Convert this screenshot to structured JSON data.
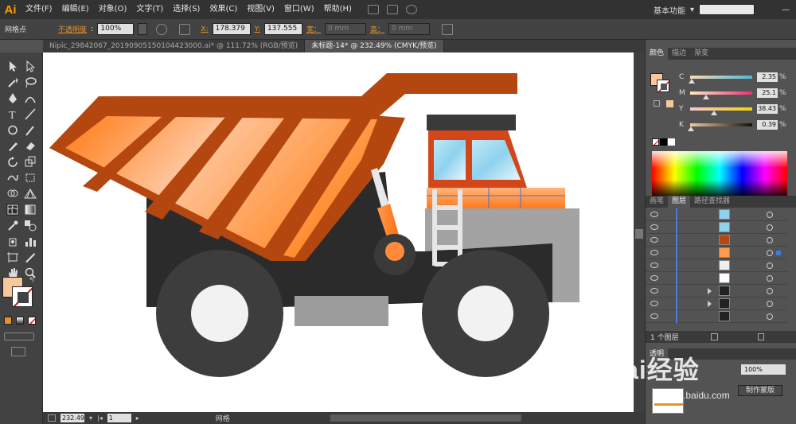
{
  "app": {
    "logo": "Ai"
  },
  "menu": [
    "文件(F)",
    "编辑(E)",
    "对象(O)",
    "文字(T)",
    "选择(S)",
    "效果(C)",
    "视图(V)",
    "窗口(W)",
    "帮助(H)"
  ],
  "workspace": {
    "label": "基本功能"
  },
  "control": {
    "tool_label": "网格点",
    "opacity_label": "不透明度",
    "opacity_value": "100%",
    "x_label": "X:",
    "x_value": "178.379",
    "y_label": "Y:",
    "y_value": "137.555",
    "w_label": "宽：",
    "w_value": "0 mm",
    "h_label": "高：",
    "h_value": "0 mm"
  },
  "tabs": [
    {
      "label": "Nipic_29842067_20190905150104423000.ai* @ 111.72% (RGB/预览)"
    },
    {
      "label": "未标题-14* @ 232.49% (CMYK/预览)"
    }
  ],
  "status": {
    "zoom": "232.49",
    "page": "1",
    "label": "网格"
  },
  "color_panel": {
    "tabs": [
      "颜色",
      "描边",
      "渐变"
    ],
    "fill_color": "#f7c89a",
    "rows": [
      {
        "letter": "C",
        "value": "2.35",
        "level": 0.02
      },
      {
        "letter": "M",
        "value": "25.1",
        "level": 0.25
      },
      {
        "letter": "Y",
        "value": "38.43",
        "level": 0.38
      },
      {
        "letter": "K",
        "value": "0.39",
        "level": 0.01
      }
    ],
    "pct": "%"
  },
  "layers_panel": {
    "tabs": [
      "画笔",
      "图层",
      "路径查找器"
    ],
    "count": "1 个图层"
  },
  "transparency_panel": {
    "tab": "透明",
    "opacity": "100%",
    "make_mask": "制作蒙版"
  },
  "watermark": {
    "main": "Bai经验",
    "sub": "jingyan.baidu.com"
  },
  "colors": {
    "accent_orange": "#e8922a",
    "selection_blue": "#3a7ddf"
  }
}
